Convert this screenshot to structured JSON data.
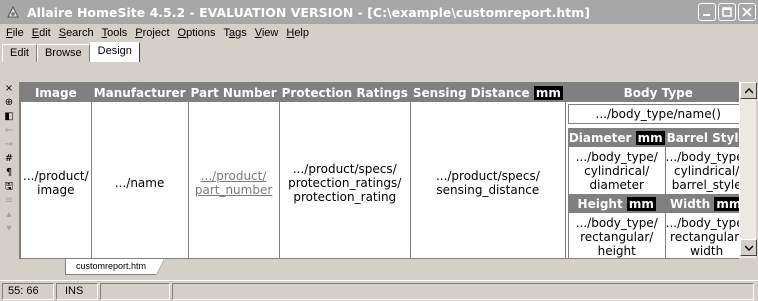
{
  "window": {
    "title": "Allaire HomeSite 4.5.2 - EVALUATION VERSION - [C:\\example\\customreport.htm]",
    "app_icon": "homesite-app-icon",
    "controls": [
      "minimize-icon",
      "maximize-icon",
      "close-icon"
    ]
  },
  "menubar": {
    "items": [
      {
        "label": "File",
        "mnemonic": "F"
      },
      {
        "label": "Edit",
        "mnemonic": "E"
      },
      {
        "label": "Search",
        "mnemonic": "S"
      },
      {
        "label": "Tools",
        "mnemonic": "T"
      },
      {
        "label": "Project",
        "mnemonic": "P"
      },
      {
        "label": "Options",
        "mnemonic": "O"
      },
      {
        "label": "Tags",
        "mnemonic": "a"
      },
      {
        "label": "View",
        "mnemonic": "V"
      },
      {
        "label": "Help",
        "mnemonic": "H"
      }
    ]
  },
  "tabs": [
    {
      "label": "Edit"
    },
    {
      "label": "Browse"
    },
    {
      "label": "Design",
      "active": true
    }
  ],
  "left_toolbar": {
    "icons": [
      "close-icon",
      "anchor-icon",
      "paragraph-toggle-icon",
      "indent-icon",
      "outdent-icon",
      "hash-icon",
      "pilcrow-icon",
      "save-icon",
      "align-icon",
      "triangle-up-icon",
      "triangle-down-icon"
    ],
    "glyphs": [
      "×",
      "⊕",
      "◧",
      "⇜",
      "⇝",
      "#",
      "¶",
      "🖫",
      "≡",
      "▴",
      "▾"
    ]
  },
  "table": {
    "headers": {
      "image": "Image",
      "manufacturer": "Manufacturer",
      "part_number": "Part Number",
      "protection_ratings": "Protection Ratings",
      "sensing_distance": "Sensing Distance",
      "sensing_unit": "mm",
      "body_type": "Body Type"
    },
    "row": {
      "image": ".../product/ image",
      "manufacturer": ".../name",
      "part_number": ".../product/ part_number",
      "protection_ratings": ".../product/specs/ protection_ratings/ protection_rating",
      "sensing_distance": ".../product/specs/ sensing_distance"
    },
    "body_type": {
      "name": ".../body_type/name()",
      "cyl_headers": {
        "diameter": "Diameter",
        "diameter_unit": "mm",
        "barrel_style": "Barrel Style"
      },
      "cyl_values": {
        "diameter": ".../body_type/ cylindrical/ diameter",
        "barrel_style": ".../body_type/ cylindrical/ barrel_style"
      },
      "rect_headers": {
        "height": "Height",
        "height_unit": "mm",
        "width": "Width",
        "width_unit": "mm"
      },
      "rect_values": {
        "height": ".../body_type/ rectangular/ height",
        "width": ".../body_type/ rectangular/ width"
      }
    }
  },
  "file_tab": {
    "label": "customreport.htm"
  },
  "status": {
    "position": "55: 66",
    "mode": "INS"
  }
}
